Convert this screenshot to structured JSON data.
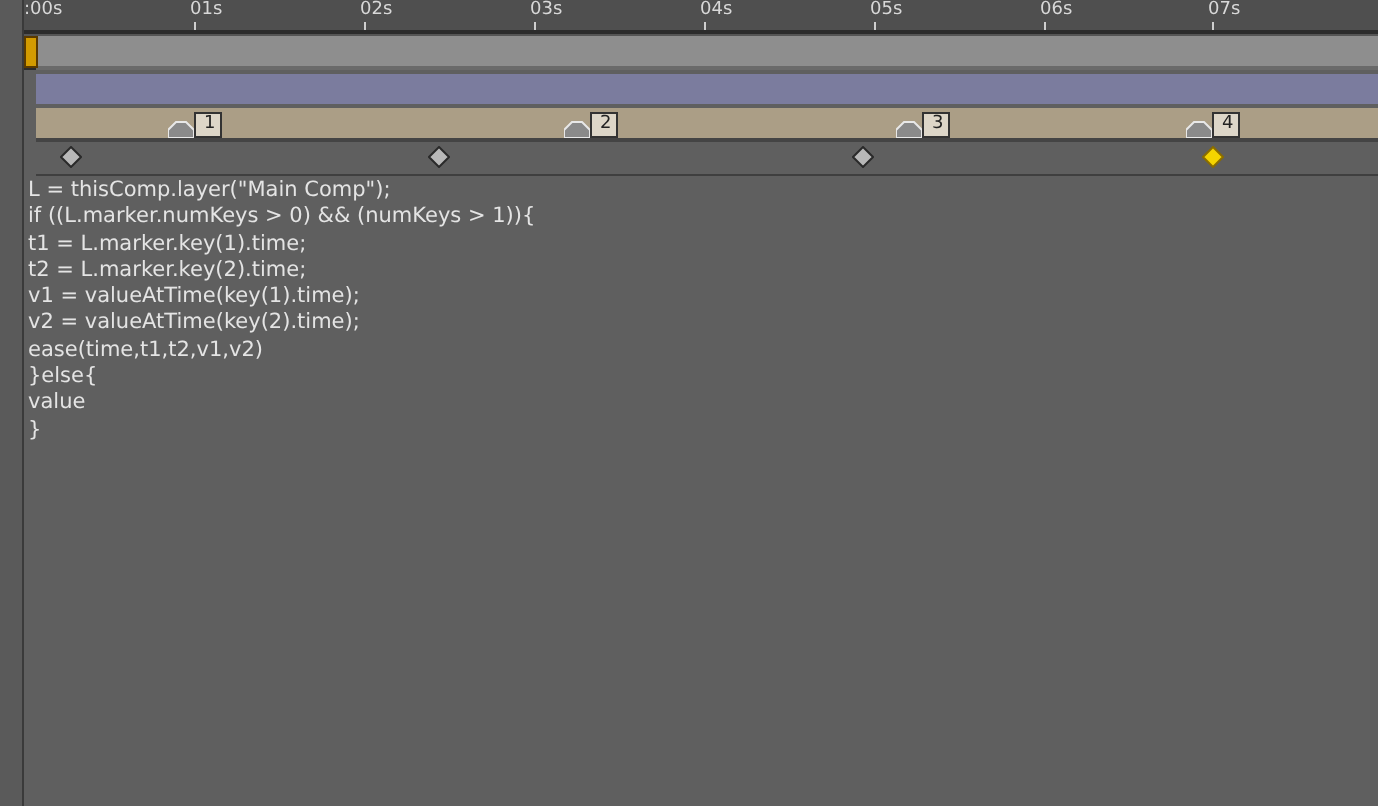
{
  "ruler": {
    "ticks": [
      ":00s",
      "01s",
      "02s",
      "03s",
      "04s",
      "05s",
      "06s",
      "07s"
    ]
  },
  "markers": [
    {
      "label": "1"
    },
    {
      "label": "2"
    },
    {
      "label": "3"
    },
    {
      "label": "4"
    }
  ],
  "keyframes": [
    {
      "selected": false
    },
    {
      "selected": false
    },
    {
      "selected": false
    },
    {
      "selected": true
    }
  ],
  "expression": {
    "lines": [
      "L = thisComp.layer(\"Main Comp\");",
      "if ((L.marker.numKeys > 0) && (numKeys > 1)){",
      "t1 = L.marker.key(1).time;",
      "t2 = L.marker.key(2).time;",
      "v1 = valueAtTime(key(1).time);",
      "v2 = valueAtTime(key(2).time);",
      "ease(time,t1,t2,v1,v2)",
      "}else{",
      "value",
      "}"
    ]
  }
}
